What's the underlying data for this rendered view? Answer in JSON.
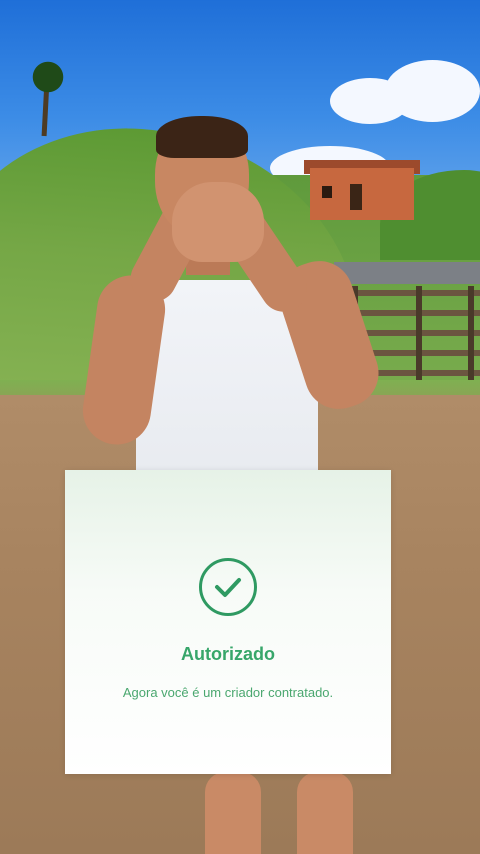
{
  "colors": {
    "accent": "#2f9a62",
    "title": "#37a66a",
    "subtitle": "#4aa76f"
  },
  "dialog": {
    "icon": "check-circle-icon",
    "title": "Autorizado",
    "message": "Agora você é um criador contratado."
  }
}
